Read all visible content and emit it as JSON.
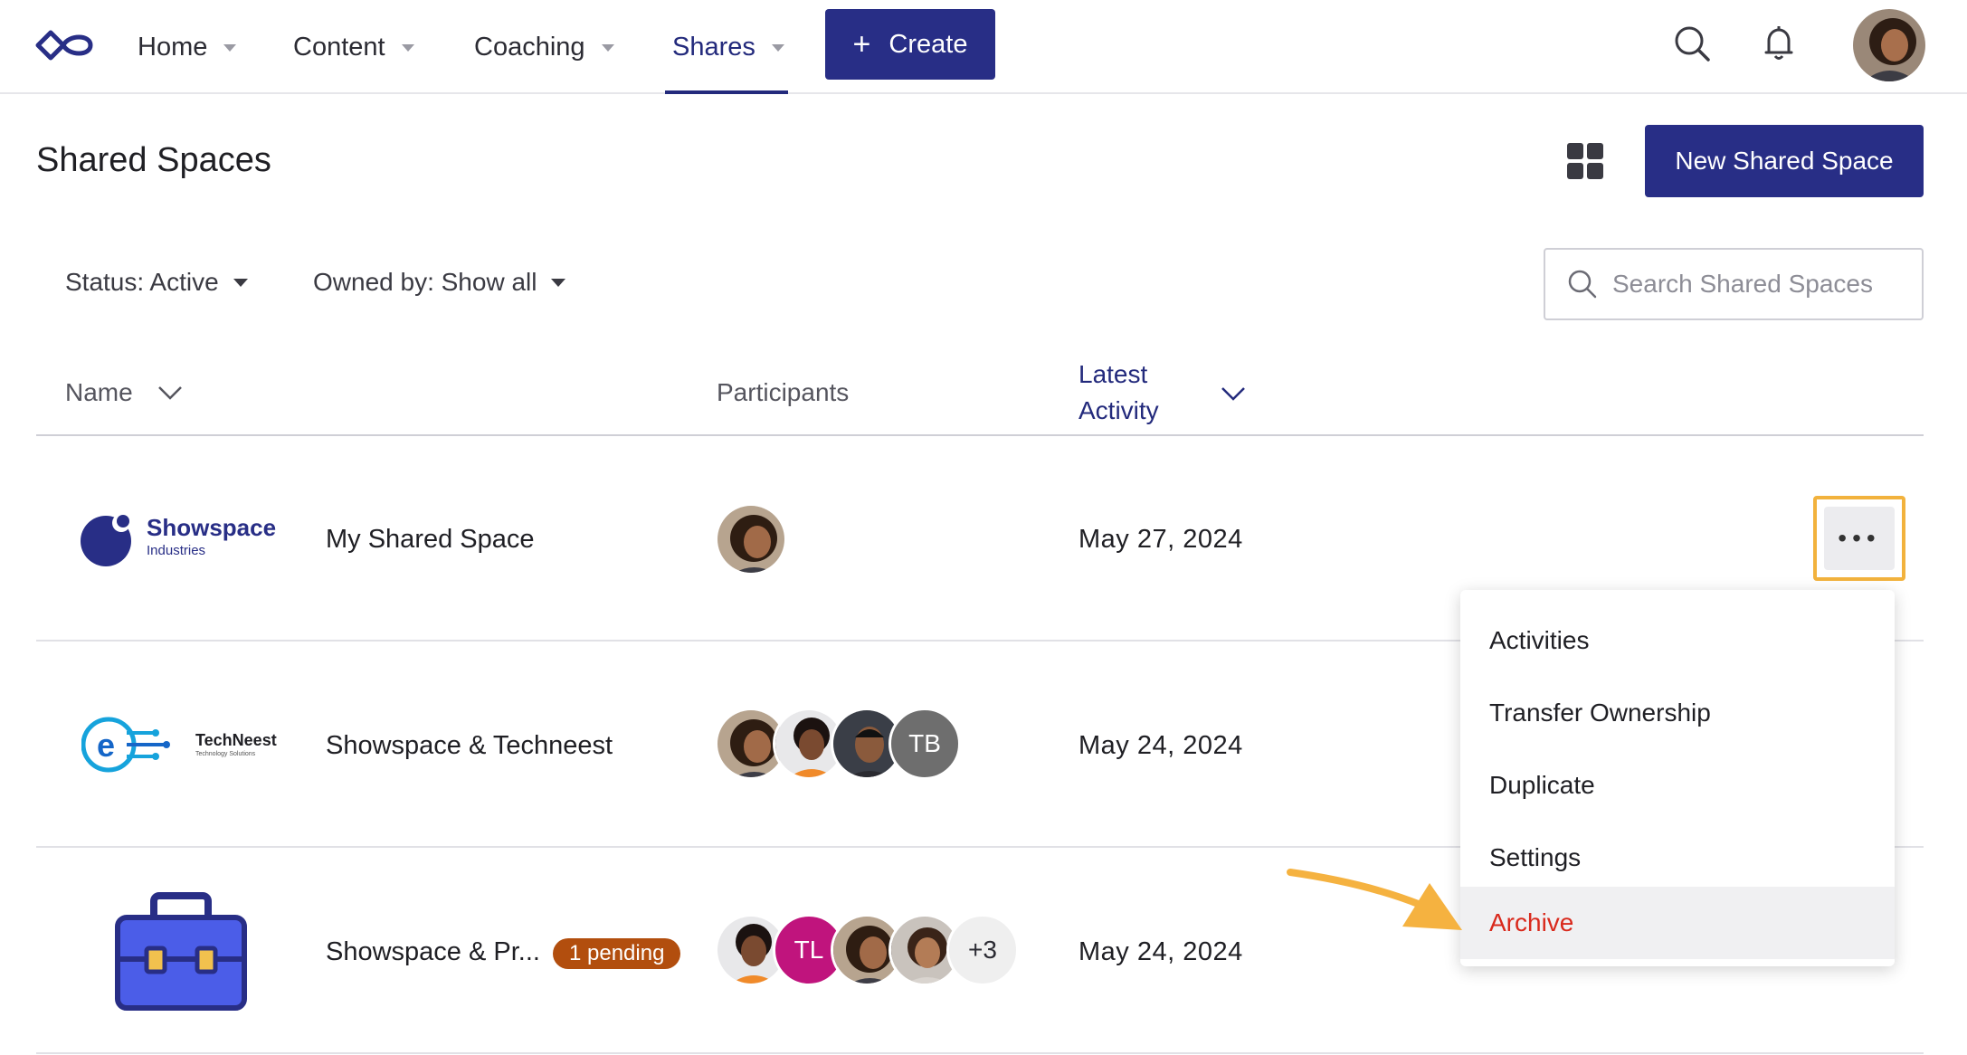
{
  "nav": {
    "items": [
      {
        "label": "Home"
      },
      {
        "label": "Content"
      },
      {
        "label": "Coaching"
      },
      {
        "label": "Shares"
      }
    ],
    "create_label": "Create"
  },
  "header": {
    "title": "Shared Spaces",
    "new_button": "New Shared Space"
  },
  "filters": {
    "status": "Status: Active",
    "owned_by": "Owned by: Show all",
    "search_placeholder": "Search Shared Spaces"
  },
  "table": {
    "columns": {
      "name": "Name",
      "participants": "Participants",
      "latest_activity": "Latest Activity",
      "latest_activity_line1": "Latest",
      "latest_activity_line2": "Activity"
    },
    "rows": [
      {
        "logo": "Showspace Industries",
        "logo_line1": "Showspace",
        "logo_line2": "Industries",
        "name": "My Shared Space",
        "date": "May 27, 2024"
      },
      {
        "logo": "TechNeest Technology Solutions",
        "logo_line1": "TechNeest",
        "logo_line2": "Technology Solutions",
        "name": "Showspace & Techneest",
        "participant_initials": "TB",
        "date": "May 24, 2024"
      },
      {
        "logo": "briefcase-icon",
        "name": "Showspace & Pr...",
        "badge": "1 pending",
        "participant_initials": "TL",
        "participant_more": "+3",
        "date": "May 24, 2024"
      }
    ]
  },
  "menu": {
    "items": [
      "Activities",
      "Transfer Ownership",
      "Duplicate",
      "Settings",
      "Archive"
    ]
  },
  "colors": {
    "brand": "#282e86",
    "active_nav": "#232a7c",
    "danger": "#d9291c",
    "badge": "#b24e0e",
    "highlight": "#f2b23d"
  }
}
